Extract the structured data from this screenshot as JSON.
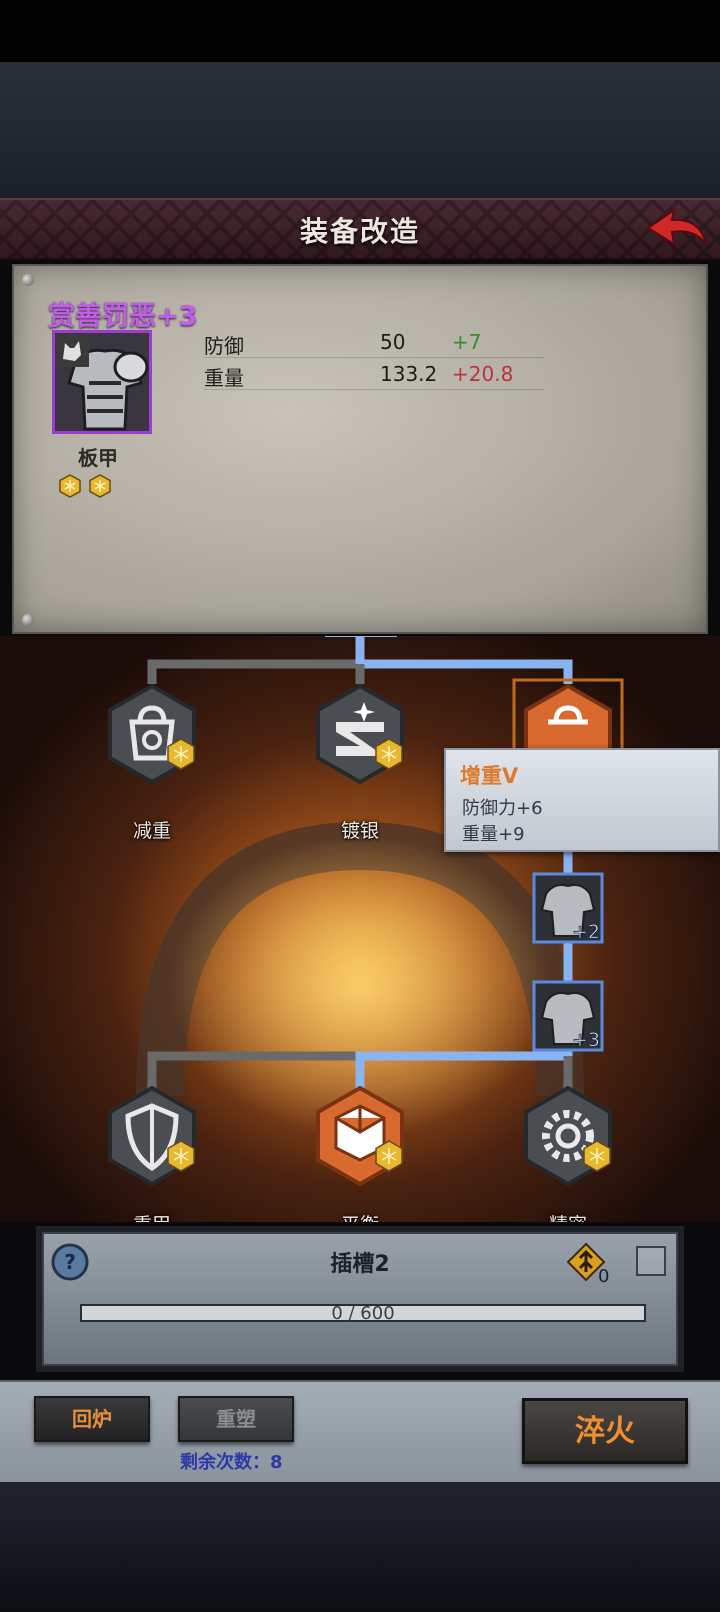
{
  "header": {
    "title": "装备改造"
  },
  "item": {
    "name": "赏善罚恶+3",
    "type": "板甲",
    "rarity_color": "#c05ee8",
    "icon": "plate-armor-icon",
    "badge_icon": "wolf-icon",
    "gem_slots": 2,
    "stats": [
      {
        "label": "防御",
        "value": "50",
        "bonus": "+7"
      },
      {
        "label": "重量",
        "value": "133.2",
        "bonus": "+20.8"
      }
    ]
  },
  "tree": {
    "upper_nodes": [
      {
        "label": "减重",
        "icon": "weight-reduce-icon"
      },
      {
        "label": "镀银",
        "icon": "silver-plating-icon"
      },
      {
        "label": "增重",
        "icon": "weight-add-icon"
      }
    ],
    "upgrade_nodes": [
      {
        "label": "+2",
        "icon": "plate-armor-icon"
      },
      {
        "label": "+3",
        "icon": "plate-armor-icon"
      }
    ],
    "lower_nodes": [
      {
        "label": "重甲",
        "icon": "shield-icon"
      },
      {
        "label": "平衡",
        "icon": "cube-icon"
      },
      {
        "label": "精密",
        "icon": "gear-icon"
      }
    ]
  },
  "tooltip": {
    "title": "增重V",
    "lines": [
      "防御力+6",
      "重量+9"
    ]
  },
  "socket": {
    "title": "插槽2",
    "count": "0",
    "progress_text": "0 / 600",
    "progress_current": 0,
    "progress_max": 600
  },
  "buttons": {
    "recycle": "回炉",
    "reshape": "重塑",
    "remaining": "剩余次数：8",
    "quench": "淬火"
  },
  "colors": {
    "active_line": "#8ab4f0",
    "inactive_line": "#6a6a6a",
    "accent_orange": "#e8903a",
    "gem_gold": "#e8b830"
  }
}
